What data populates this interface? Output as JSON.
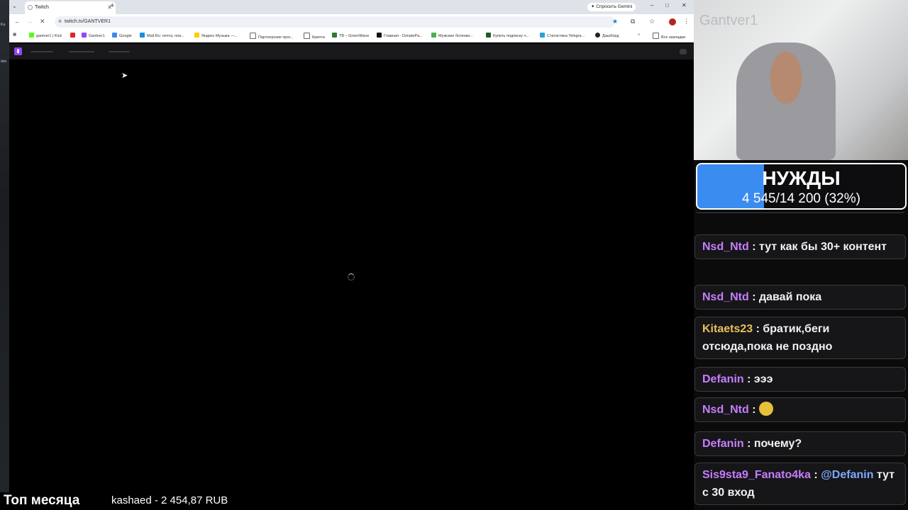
{
  "browser": {
    "tab_title": "Twitch",
    "url": "twitch.tv/GANTVER1",
    "gemini_button": "Спросить Gemini",
    "bookmarks": [
      {
        "label": "gantver1 | Kick",
        "color": "#53fc18"
      },
      {
        "label": "",
        "color": "#e0262d"
      },
      {
        "label": "Gantver1",
        "color": "#9146ff"
      },
      {
        "label": "Google",
        "color": "#4285f4"
      },
      {
        "label": "Mail.Ru: почта, пои...",
        "color": "#168de2"
      },
      {
        "label": "Яндекс Музыка —...",
        "color": "#ffcc00"
      },
      {
        "label": "Партнерские прог...",
        "color": "#666666"
      },
      {
        "label": "Крипта",
        "color": "#666666"
      },
      {
        "label": "TB – GreenWave",
        "color": "#2e7d32"
      },
      {
        "label": "Главная - DonatePa...",
        "color": "#111111"
      },
      {
        "label": "Мужские ботинки...",
        "color": "#4caf50"
      },
      {
        "label": "Купить подписку ч...",
        "color": "#1b5e20"
      },
      {
        "label": "Статистика Telegra...",
        "color": "#2aa1da"
      },
      {
        "label": "Дашборд",
        "color": "#222222"
      },
      {
        "label": "Все закладки",
        "color": "#666666"
      }
    ]
  },
  "desktop": {
    "side_text_1": "Ka",
    "side_text_2": "don"
  },
  "webcam": {
    "watermark": "Gantver1"
  },
  "goal": {
    "title": "НУЖДЫ",
    "progress_text": "4 545/14 200 (32%)",
    "progress_fraction": 0.32,
    "fill_color": "#3b8cf0"
  },
  "chat": {
    "messages": [
      {
        "user": "Nsd_Ntd",
        "user_color": "#c77dff",
        "text": "тут как бы 30+ контент"
      },
      {
        "user": "Nsd_Ntd",
        "user_color": "#c77dff",
        "text": "давай пока"
      },
      {
        "user": "Kitaets23",
        "user_color": "#e8c15a",
        "text": "братик,беги отсюда,пока не поздно"
      },
      {
        "user": "Defanin",
        "user_color": "#c77dff",
        "text": "эээ"
      },
      {
        "user": "Nsd_Ntd",
        "user_color": "#c77dff",
        "emote": "emote"
      },
      {
        "user": "Defanin",
        "user_color": "#c77dff",
        "text": "почему?"
      },
      {
        "user": "Sis9sta9_Fanato4ka",
        "user_color": "#c77dff",
        "mention": "@Defanin",
        "text": "тут с 30 вход"
      }
    ]
  },
  "overlay": {
    "top_label": "Топ месяца",
    "donor": "kashaed - 2 454,87 RUB"
  }
}
